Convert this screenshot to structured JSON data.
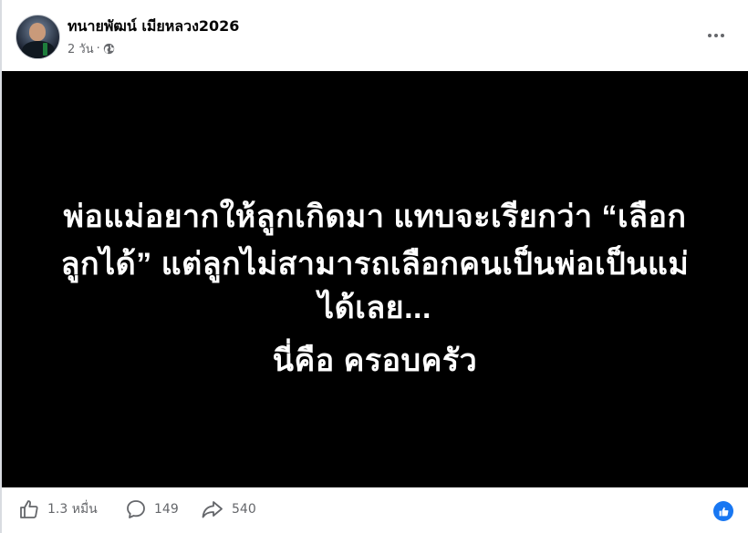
{
  "post": {
    "author_name": "ทนายพัฒน์ เมียหลวง2026",
    "time": "2 วัน",
    "separator": "·",
    "privacy_icon": "globe-icon",
    "more_icon": "more-options-icon"
  },
  "media": {
    "line1": "พ่อแม่อยากให้ลูกเกิดมา แทบจะเรียกว่า “เลือก",
    "line2": "ลูกได้” แต่ลูกไม่สามารถเลือกคนเป็นพ่อเป็นแม่",
    "line3": "ได้เลย...",
    "line4": "นี่คือ ครอบครัว",
    "background_color": "#000000",
    "text_color": "#ffffff"
  },
  "footer": {
    "likes": "1.3 หมื่น",
    "comments": "149",
    "shares": "540",
    "like_icon": "thumbs-up-icon",
    "comment_icon": "comment-icon",
    "share_icon": "share-icon",
    "reaction_icon": "like-reaction-icon",
    "reaction_color": "#1877f2"
  }
}
